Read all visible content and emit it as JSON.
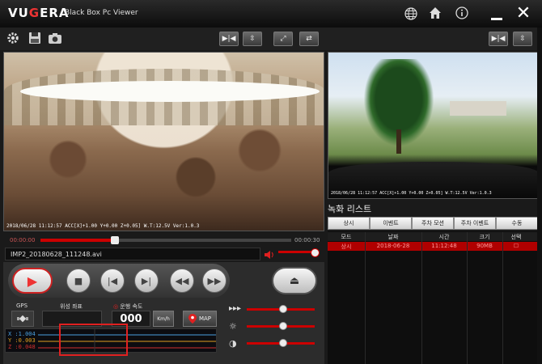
{
  "app": {
    "logo": "VUGERA",
    "subtitle": "Black Box Pc Viewer"
  },
  "titlebar_icons": [
    "globe-icon",
    "home-icon",
    "info-icon"
  ],
  "osd": {
    "front": "2018/06/28 11:12:57 ACC[X]+1.00 Y+0.00 Z+0.05] W.T:12.5V Ver:1.0.3",
    "rear": "2018/06/28 11:12:57 ACC[X]+1.00 Y+0.00 Z+0.05] W.T:12.5V Ver:1.0.3"
  },
  "timeline": {
    "current": "00:00:00",
    "total": "00:00:30",
    "progress": 0.3
  },
  "filename": "IMP2_20180628_111248.avi",
  "gps": {
    "gps_label": "GPS",
    "coord_label": "위성 좌표",
    "speed_label": "운행 속도",
    "speed_value": "000",
    "unit": "Km/h",
    "map_label": "MAP"
  },
  "gsensor": {
    "x": "X :1.004",
    "y": "Y :0.003",
    "z": "Z :0.048"
  },
  "sliders": {
    "speed": 0.52,
    "brightness": 0.52,
    "contrast": 0.52
  },
  "recording_list": {
    "title": "녹화 리스트",
    "tabs": [
      "상시",
      "이벤트",
      "주차 모션",
      "주차 이벤트",
      "수동"
    ],
    "columns": [
      "모드",
      "날짜",
      "시간",
      "크기",
      "선택"
    ],
    "rows": [
      {
        "mode": "상시",
        "date": "2018-06-28",
        "time": "11:12:48",
        "size": "90MB",
        "select": "☐"
      }
    ]
  },
  "colors": {
    "accent": "#e02020",
    "selected_row": "#b00000"
  }
}
